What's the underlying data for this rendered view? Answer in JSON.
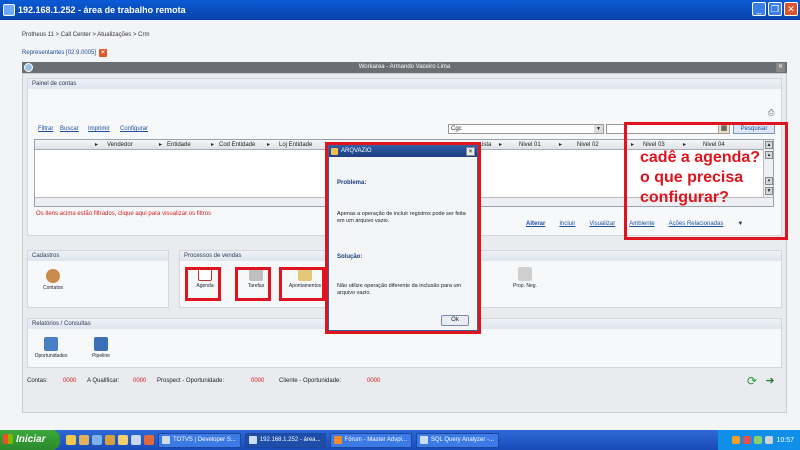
{
  "remote_window": {
    "title": "192.168.1.252 - área de trabalho remota"
  },
  "breadcrumb": "Protheus 11 > Call Center > Atualizações > Crm",
  "open_tab": "Representantes [02.9.0005]",
  "workarea_title": "Workarea - Armando Vaceiro Lima",
  "painel": {
    "title": "Painel de contas",
    "links": [
      "Filtrar",
      "Buscar",
      "Imprimir",
      "Configurar"
    ],
    "combo_value": "Cgc",
    "search_button": "Pesquisar",
    "columns": [
      "Vendedor",
      "Entidade",
      "Cod Entidade",
      "Loj Entidade",
      "...ista",
      "Nivel 01",
      "Nivel 02",
      "Nivel 03",
      "Nivel 04"
    ],
    "filter_note": "Os itens acima estão filtrados, clique aqui para visualizar os filtros",
    "actions": [
      "Alterar",
      "Incluir",
      "Visualizar",
      "Ambiente",
      "Ações Relacionadas"
    ]
  },
  "cadastros": {
    "title": "Cadastros",
    "items": [
      {
        "label": "Contatos",
        "icon": "contacts-icon"
      }
    ]
  },
  "processos": {
    "title": "Processos de vendas",
    "items": [
      {
        "label": "Agenda",
        "icon": "calendar-icon"
      },
      {
        "label": "Tarefas",
        "icon": "tasks-icon"
      },
      {
        "label": "Apontamentos",
        "icon": "notes-icon"
      },
      {
        "label": "Prop. Neg.",
        "icon": "proposal-icon"
      }
    ]
  },
  "relatorios": {
    "title": "Relatórios / Consultas",
    "items": [
      {
        "label": "Oportunidades",
        "icon": "opportunities-icon"
      },
      {
        "label": "Pipeline",
        "icon": "pipeline-icon"
      }
    ]
  },
  "status": {
    "contas_label": "Contas:",
    "contas_value": "0000",
    "qualificar_label": "A Qualificar:",
    "qualificar_value": "0000",
    "prospect_label": "Prospect - Oportunidade:",
    "prospect_value": "0000",
    "cliente_label": "Cliente - Oportunidade:",
    "cliente_value": "0000"
  },
  "dialog": {
    "title": "ARQVAZIO",
    "problem_label": "Problema:",
    "problem_text": "Apenas a operação de incluir registros pode ser feita em um arquivo vazio.",
    "solution_label": "Solução:",
    "solution_text": "Não utilize operação diferente da inclusão para um arquivo vazio.",
    "ok_label": "Ok"
  },
  "annotation": {
    "line1": "cadê a agenda?",
    "line2": "o que precisa",
    "line3": "configurar?"
  },
  "taskbar": {
    "start_label": "Iniciar",
    "tasks": [
      "TOTVS | Developer S...",
      "192.168.1.252 - área...",
      "Fórum - Master Advpl...",
      "SQL Query Analyzer -..."
    ],
    "clock": "10:57"
  },
  "colors": {
    "accent_red": "#e0141e",
    "link_blue": "#1b4f9c"
  }
}
